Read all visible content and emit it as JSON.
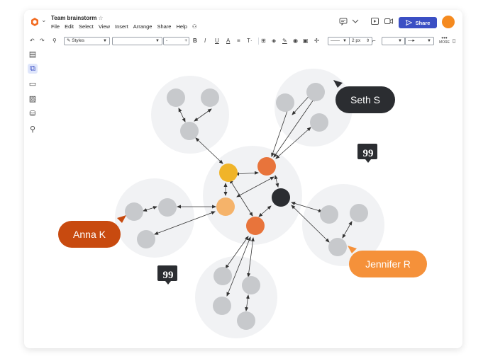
{
  "document": {
    "title": "Team brainstorm",
    "star": "☆"
  },
  "menu": [
    "File",
    "Edit",
    "Select",
    "View",
    "Insert",
    "Arrange",
    "Share",
    "Help"
  ],
  "header": {
    "share_label": "Share"
  },
  "toolbar": {
    "styles_label": "Styles",
    "font_size": "-",
    "bold": "B",
    "italic": "I",
    "underline": "U",
    "text_color": "A",
    "align": "≡",
    "text_tools": "T·",
    "line_width": "2 px",
    "more_label": "MORE"
  },
  "collaborators": [
    {
      "name": "Seth S",
      "color": "#2b2d31"
    },
    {
      "name": "Anna K",
      "color": "#c84a0f"
    },
    {
      "name": "Jennifer R",
      "color": "#f5913a"
    }
  ],
  "comment_glyph": "99",
  "colors": {
    "accent": "#3b4fc4",
    "node_gray": "#c7c9cc",
    "cluster_bg": "#f1f2f4",
    "node_yellow": "#f0b429",
    "node_orange": "#e8743b",
    "node_light_orange": "#f5b36a",
    "node_dark": "#2b2d31"
  }
}
